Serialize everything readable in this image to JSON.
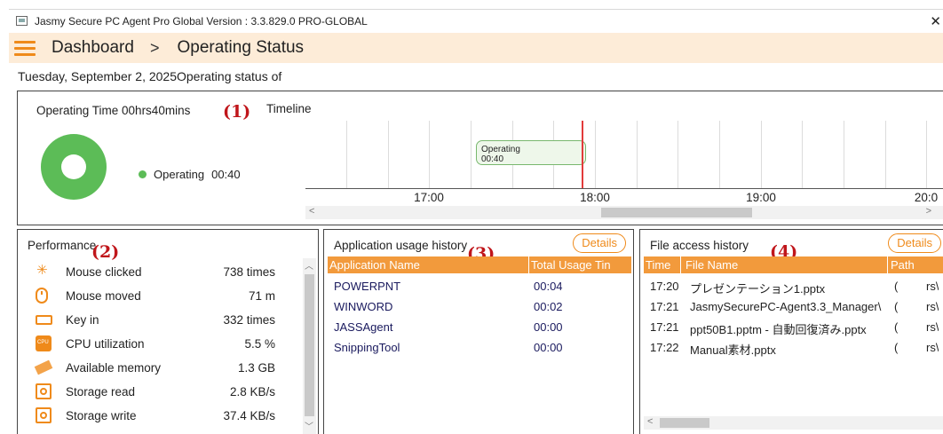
{
  "window": {
    "title": "Jasmy Secure PC Agent Pro Global Version : 3.3.829.0 PRO-GLOBAL",
    "close_glyph": "✕"
  },
  "header": {
    "breadcrumb_root": "Dashboard",
    "breadcrumb_sep": ">",
    "breadcrumb_current": "Operating Status"
  },
  "date_line": "Tuesday, September 2, 2025Operating status of",
  "markers": [
    "(1)",
    "(2)",
    "(3)",
    "(4)"
  ],
  "operating": {
    "title": "Operating Time 00hrs40mins",
    "legend_label": "Operating",
    "legend_value": "00:40",
    "donut_fraction": 1.0,
    "color": "#5cbc57"
  },
  "timeline": {
    "label": "Timeline",
    "bar_label": "Operating",
    "bar_sublabel": "00:40",
    "ticks": [
      "17:00",
      "18:00",
      "19:00",
      "20:0"
    ]
  },
  "performance": {
    "title": "Performance",
    "rows": [
      {
        "icon": "mouse-click-icon",
        "label": "Mouse clicked",
        "value": "738 times"
      },
      {
        "icon": "mouse-icon",
        "label": "Mouse moved",
        "value": "71 m"
      },
      {
        "icon": "keyboard-icon",
        "label": "Key in",
        "value": "332 times"
      },
      {
        "icon": "cpu-icon",
        "label": "CPU utilization",
        "value": "5.5 %"
      },
      {
        "icon": "memory-icon",
        "label": "Available memory",
        "value": "1.3 GB"
      },
      {
        "icon": "storage-icon",
        "label": "Storage read",
        "value": "2.8 KB/s"
      },
      {
        "icon": "storage-icon",
        "label": "Storage write",
        "value": "37.4 KB/s"
      }
    ]
  },
  "app_usage": {
    "title": "Application usage history",
    "details_label": "Details",
    "columns": [
      "Application Name",
      "Total Usage Tin"
    ],
    "rows": [
      {
        "name": "POWERPNT",
        "time": "00:04"
      },
      {
        "name": "WINWORD",
        "time": "00:02"
      },
      {
        "name": "JASSAgent",
        "time": "00:00"
      },
      {
        "name": "SnippingTool",
        "time": "00:00"
      }
    ]
  },
  "file_access": {
    "title": "File access history",
    "details_label": "Details",
    "columns": [
      "Time",
      "File Name",
      "Path"
    ],
    "rows": [
      {
        "time": "17:20",
        "name": "プレゼンテーション1.pptx",
        "c": "(",
        "path": "rs\\"
      },
      {
        "time": "17:21",
        "name": "JasmySecurePC-Agent3.3_Manager\\",
        "c": "(",
        "path": "rs\\"
      },
      {
        "time": "17:21",
        "name": "ppt50B1.pptm - 自動回復済み.pptx",
        "c": "(",
        "path": "rs\\"
      },
      {
        "time": "17:22",
        "name": "Manual素材.pptx",
        "c": "(",
        "path": "rs\\"
      }
    ]
  },
  "colors": {
    "accent": "#ef8a1a",
    "header_bg": "#fdecd8",
    "marker": "#c0161b",
    "now_line": "#e23b3b"
  }
}
